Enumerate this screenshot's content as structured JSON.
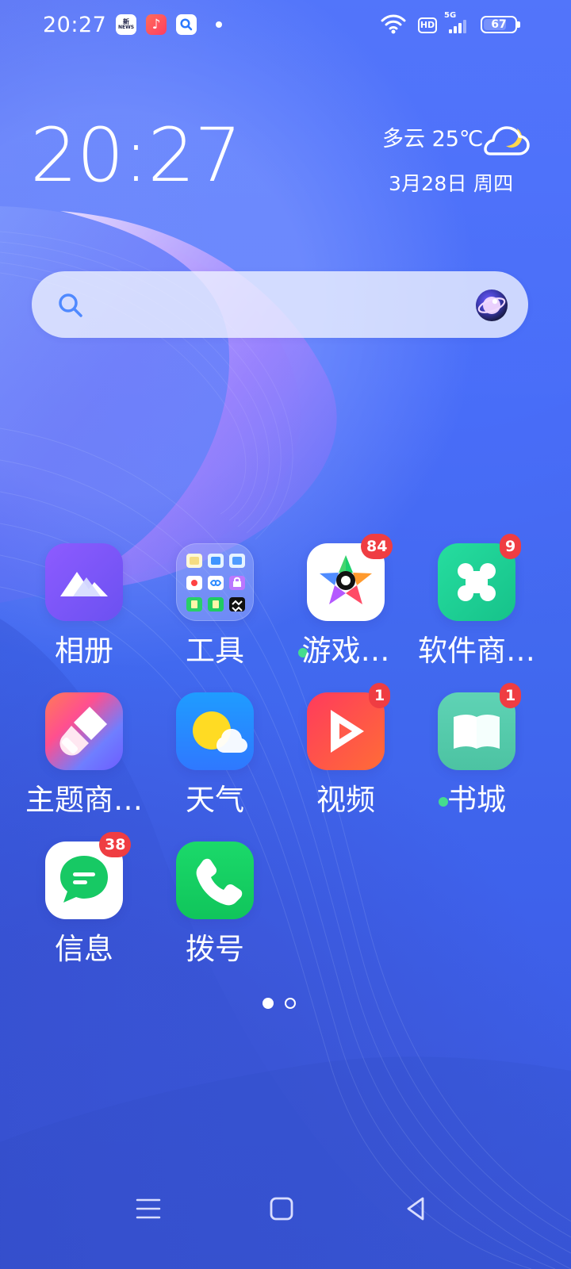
{
  "status_bar": {
    "time": "20:27",
    "network_type": "5G",
    "hd_label": "HD",
    "battery_level": "67",
    "status_icons": [
      "news-app-icon",
      "music-app-icon",
      "search-app-icon",
      "notification-dot",
      "wifi-icon",
      "hd-icon",
      "signal-icon",
      "battery-icon"
    ]
  },
  "widget": {
    "clock_time": "20:27",
    "weather_text": "多云 25℃",
    "date_text": "3月28日  周四",
    "weather_icon": "partly-cloudy-night-icon"
  },
  "search": {
    "icon": "search-icon",
    "assistant_icon": "voice-assistant-icon"
  },
  "apps": [
    {
      "label": "相册",
      "icon": "photos-icon",
      "badge": ""
    },
    {
      "label": "工具",
      "icon": "tools-folder-icon",
      "badge": ""
    },
    {
      "label": "游戏…",
      "icon": "game-center-icon",
      "badge": "84"
    },
    {
      "label": "软件商…",
      "icon": "app-store-icon",
      "badge": "9"
    },
    {
      "label": "主题商…",
      "icon": "theme-store-icon",
      "badge": ""
    },
    {
      "label": "天气",
      "icon": "weather-icon",
      "badge": ""
    },
    {
      "label": "视频",
      "icon": "video-icon",
      "badge": "1"
    },
    {
      "label": "书城",
      "icon": "bookstore-icon",
      "badge": "1"
    },
    {
      "label": "信息",
      "icon": "messages-icon",
      "badge": "38"
    },
    {
      "label": "拨号",
      "icon": "phone-icon",
      "badge": ""
    }
  ],
  "pagination": {
    "current": 1,
    "total": 2
  },
  "navigation": {
    "buttons": [
      "menu-icon",
      "home-icon",
      "back-icon"
    ]
  },
  "colors": {
    "wallpaper_primary": "#4f63ea",
    "badge": "#ef3d42",
    "notification_dot": "#45dc8e",
    "text": "#ffffff"
  }
}
